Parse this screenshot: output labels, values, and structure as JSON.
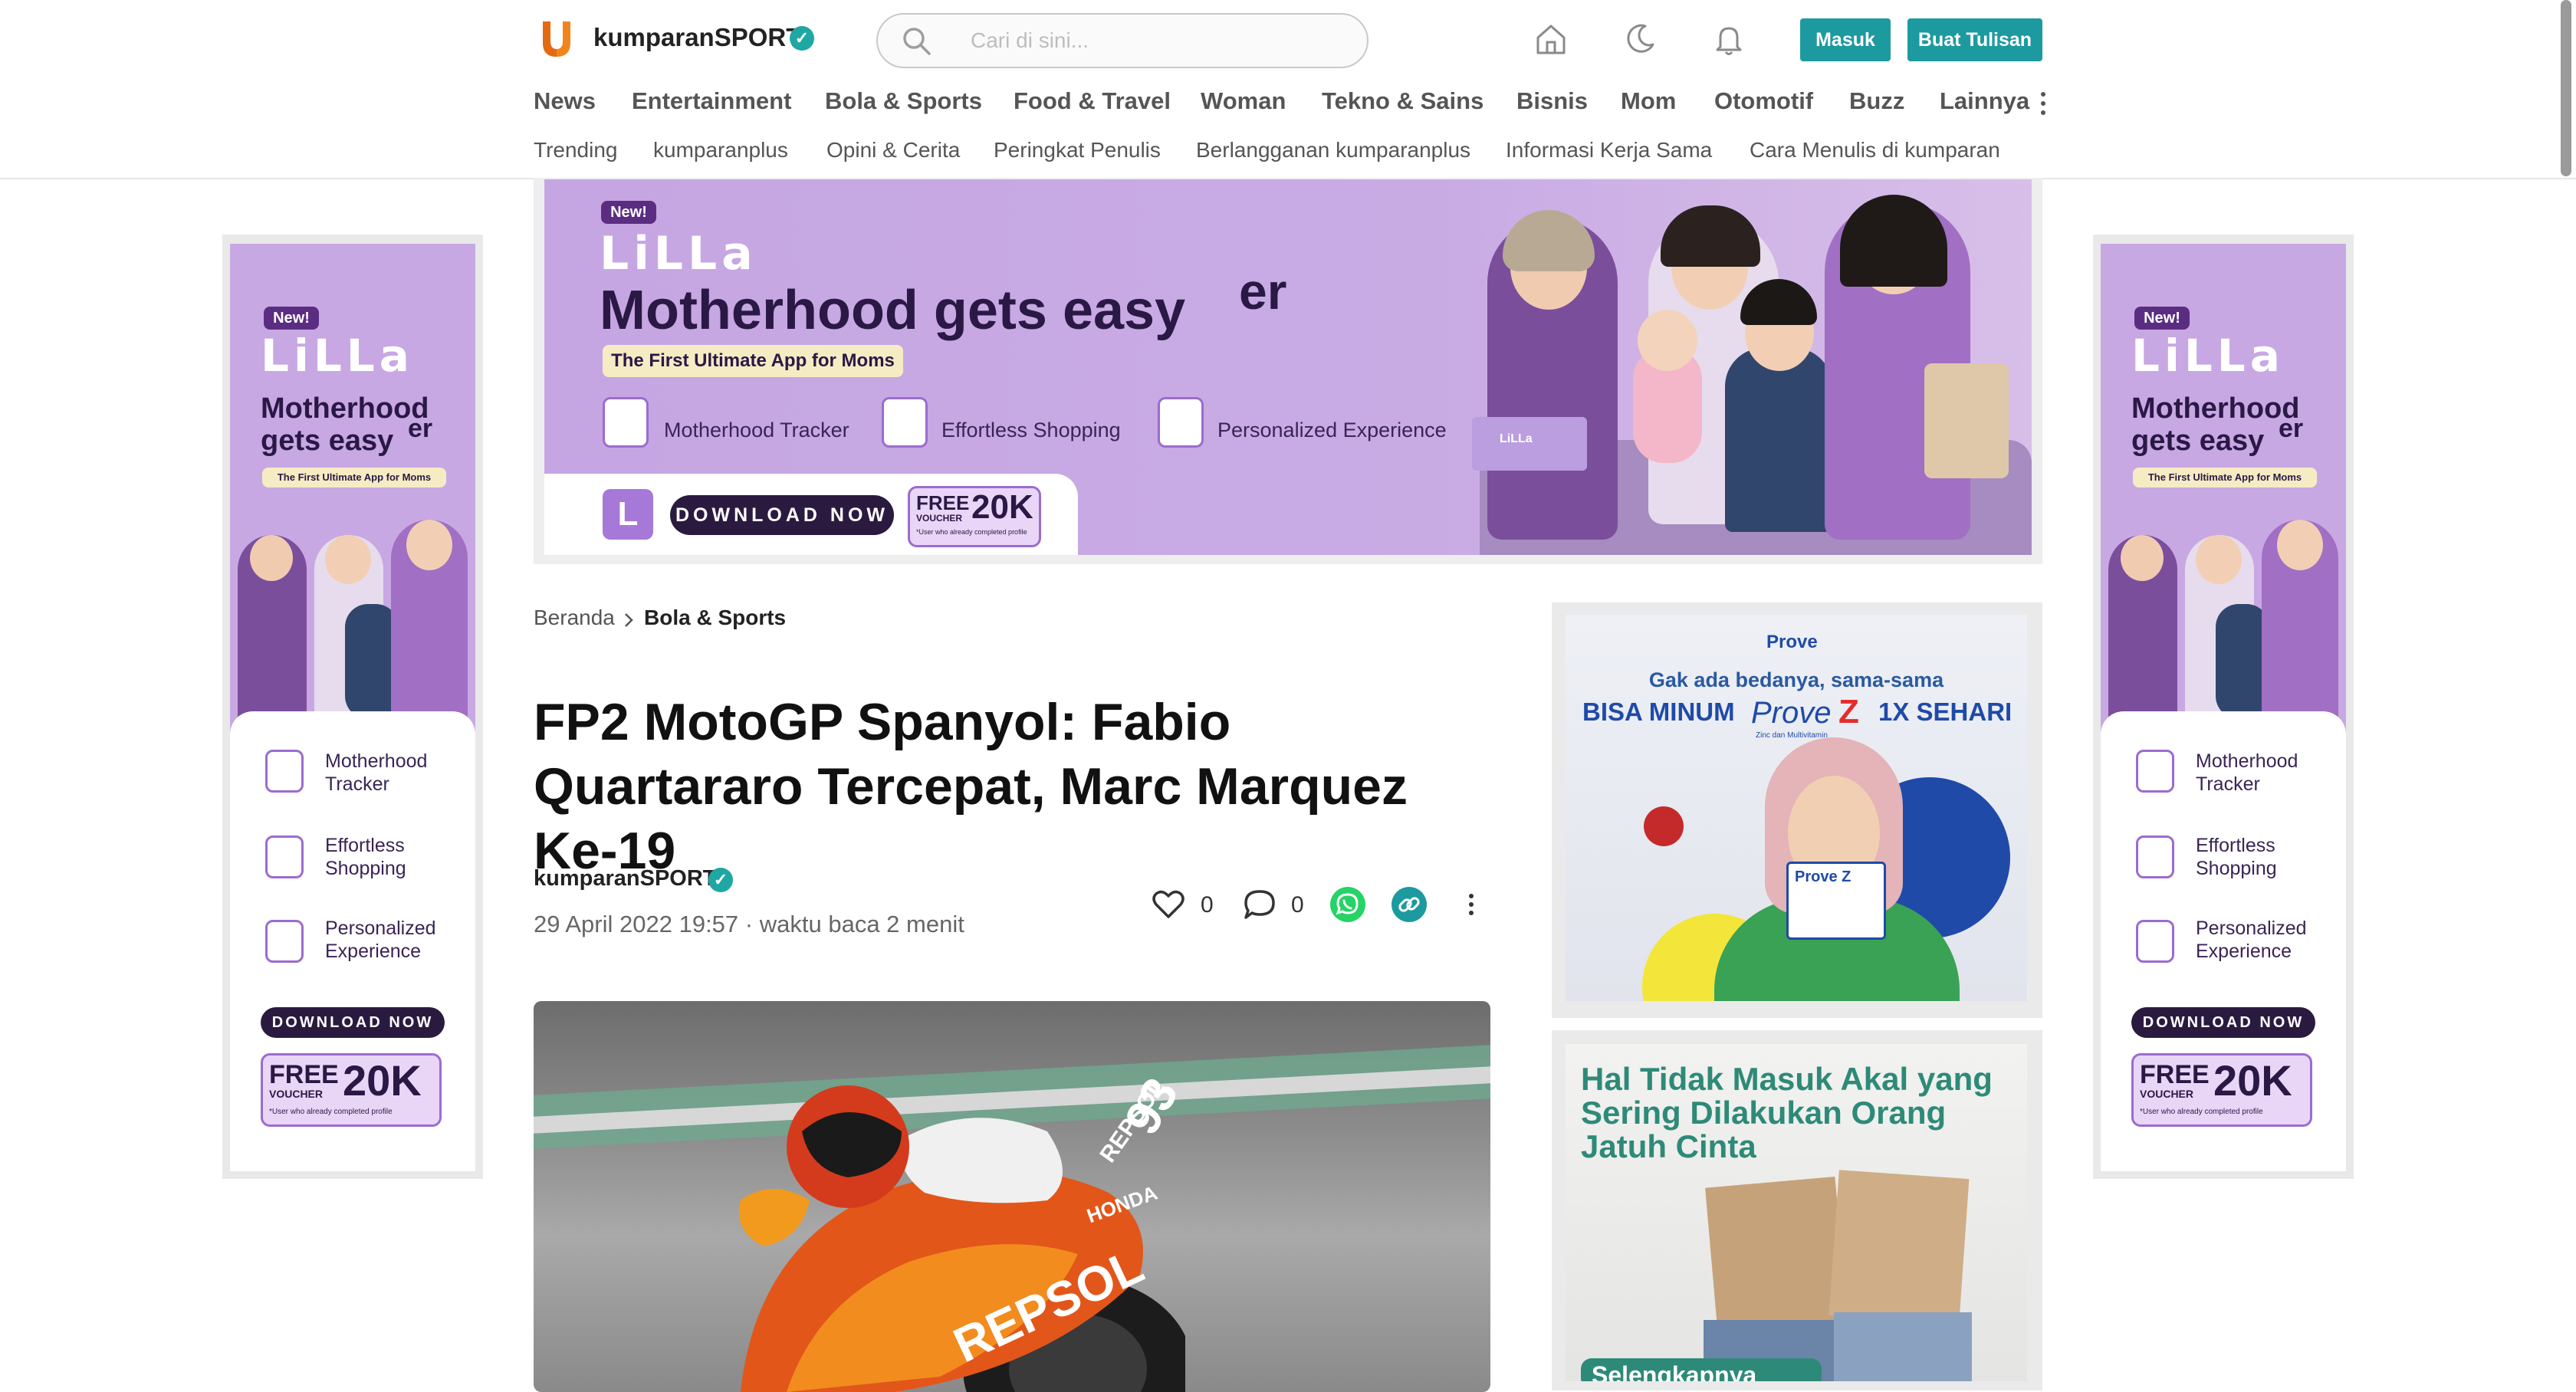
{
  "header": {
    "brand": "kumparanSPORT",
    "search_placeholder": "Cari di sini...",
    "login_label": "Masuk",
    "write_label": "Buat Tulisan",
    "icons": [
      "home-icon",
      "moon-icon",
      "bell-icon"
    ]
  },
  "nav": {
    "items": [
      "News",
      "Entertainment",
      "Bola & Sports",
      "Food & Travel",
      "Woman",
      "Tekno & Sains",
      "Bisnis",
      "Mom",
      "Otomotif",
      "Buzz",
      "Lainnya"
    ],
    "more_icon": "kebab-icon"
  },
  "subnav": {
    "items": [
      "Trending",
      "kumparanplus",
      "Opini & Cerita",
      "Peringkat Penulis",
      "Berlangganan kumparanplus",
      "Informasi Kerja Sama",
      "Cara Menulis di kumparan"
    ]
  },
  "ad_banner": {
    "new_tag": "New!",
    "logo": "LiLLa",
    "headline": "Motherhood gets easy",
    "headline_suffix": "er",
    "tagline": "The First Ultimate App for Moms",
    "features": [
      "Motherhood Tracker",
      "Effortless Shopping",
      "Personalized Experience"
    ],
    "download": "DOWNLOAD NOW",
    "voucher_free": "FREE",
    "voucher_word": "VOUCHER",
    "voucher_amount": "20K",
    "voucher_note": "*User who already completed profile",
    "box_text": "LiLLa"
  },
  "side_ad": {
    "new_tag": "New!",
    "logo": "LiLLa",
    "headline_1": "Motherhood",
    "headline_2": "gets easy",
    "headline_suffix": "er",
    "tagline": "The First Ultimate App for Moms",
    "features": [
      "Motherhood Tracker",
      "Effortless Shopping",
      "Personalized Experience"
    ],
    "download": "DOWNLOAD NOW",
    "voucher_free": "FREE",
    "voucher_word": "VOUCHER",
    "voucher_amount": "20K",
    "voucher_note": "*User who already completed profile"
  },
  "breadcrumb": {
    "home": "Beranda",
    "current": "Bola & Sports"
  },
  "article": {
    "title": "FP2 MotoGP Spanyol: Fabio Quartararo Tercepat, Marc Marquez Ke-19",
    "author": "kumparanSPORT",
    "date": "29 April 2022 19:57",
    "separator": "·",
    "read_time": "waktu baca 2 menit",
    "likes": "0",
    "comments": "0",
    "bike_number": "93",
    "bike_sponsor_1": "REPSOL",
    "bike_sponsor_2": "HONDA"
  },
  "prove_ad": {
    "brand": "Prove",
    "line1": "Gak ada bedanya, sama-sama",
    "line2_a": "BISA MINUM",
    "line2_brand": "Prove",
    "line2_z": "Z",
    "line2_b": "1X SEHARI",
    "sub_brand": "Zinc dan Multivitamin",
    "pack_label": "Prove Z"
  },
  "read_ad": {
    "headline": "Hal Tidak Masuk Akal yang Sering Dilakukan Orang Jatuh Cinta",
    "cta": "Selengkapnya"
  },
  "colors": {
    "accent": "#1d9aa0",
    "lilla_purple": "#c8a8e3",
    "lilla_dark": "#2b1a3f",
    "prove_blue": "#1f4aa8",
    "read_green": "#2e8a78"
  }
}
